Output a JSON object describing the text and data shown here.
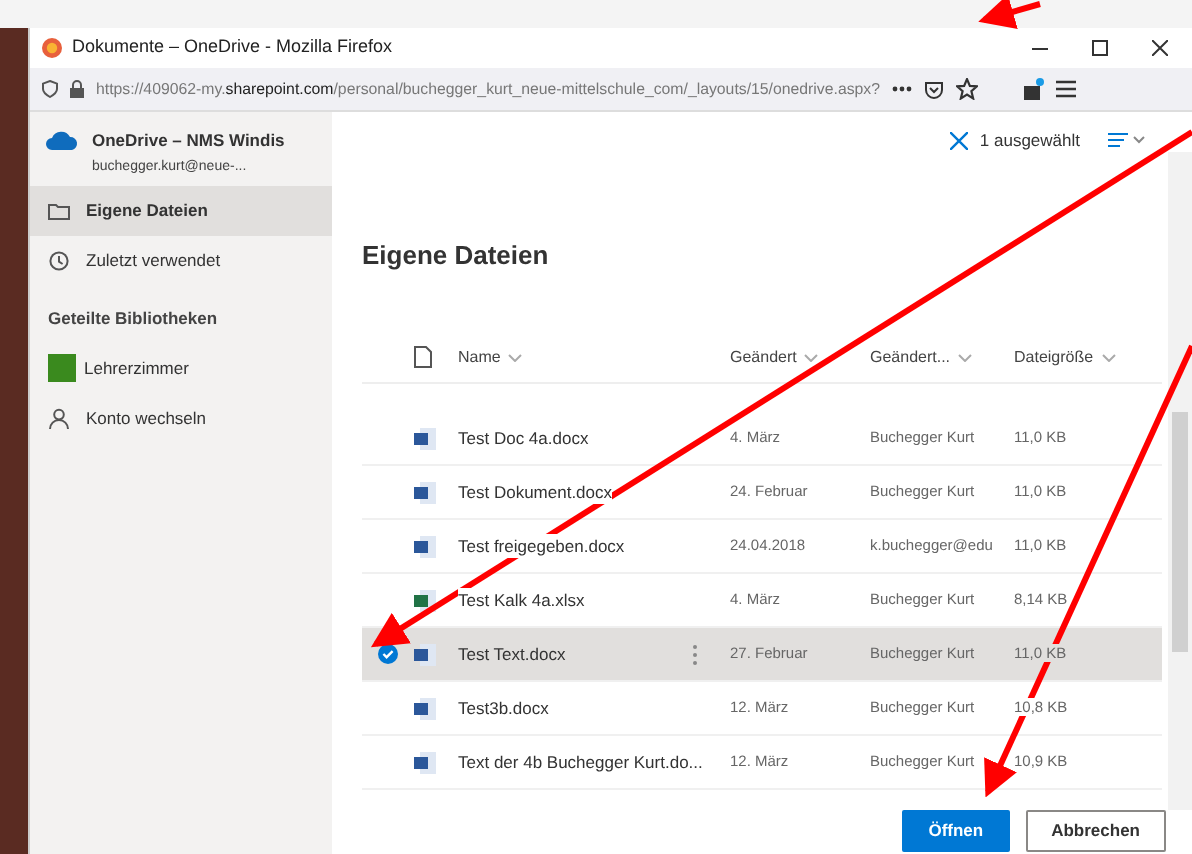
{
  "window": {
    "title": "Dokumente – OneDrive - Mozilla Firefox",
    "url": "https://409062-my.**sharepoint.com**/personal/buchegger_kurt_neue-mittelschule_com/_layouts/15/onedrive.aspx?"
  },
  "sidebar": {
    "account": "OneDrive – NMS Windis",
    "email": "buchegger.kurt@neue-...",
    "items": [
      {
        "kind": "folder",
        "label": "Eigene Dateien",
        "selected": true
      },
      {
        "kind": "recent",
        "label": "Zuletzt verwendet",
        "selected": false
      },
      {
        "kind": "section",
        "label": "Geteilte Bibliotheken"
      },
      {
        "kind": "library",
        "label": "Lehrerzimmer",
        "color": "#3a8a1e",
        "selected": false
      },
      {
        "kind": "account",
        "label": "Konto wechseln",
        "selected": false
      }
    ]
  },
  "toolbar": {
    "selection": "1 ausgewählt"
  },
  "heading": "Eigene Dateien",
  "table": {
    "columns": [
      "Name",
      "Geändert",
      "Geändert...",
      "Dateigröße"
    ],
    "rows": [
      {
        "kind": "word",
        "name": "Test Doc 4a.docx",
        "modified": "4. März",
        "modified_by": "Buchegger Kurt",
        "size": "11,0 KB",
        "selected": false
      },
      {
        "kind": "word",
        "name": "Test Dokument.docx",
        "modified": "24. Februar",
        "modified_by": "Buchegger Kurt",
        "size": "11,0 KB",
        "selected": false
      },
      {
        "kind": "word",
        "name": "Test freigegeben.docx",
        "modified": "24.04.2018",
        "modified_by": "k.buchegger@edu",
        "size": "11,0 KB",
        "selected": false
      },
      {
        "kind": "excel",
        "name": "Test Kalk 4a.xlsx",
        "modified": "4. März",
        "modified_by": "Buchegger Kurt",
        "size": "8,14 KB",
        "selected": false
      },
      {
        "kind": "word",
        "name": "Test Text.docx",
        "modified": "27. Februar",
        "modified_by": "Buchegger Kurt",
        "size": "11,0 KB",
        "selected": true
      },
      {
        "kind": "word",
        "name": "Test3b.docx",
        "modified": "12. März",
        "modified_by": "Buchegger Kurt",
        "size": "10,8 KB",
        "selected": false
      },
      {
        "kind": "word",
        "name": "Text der 4b Buchegger Kurt.do...",
        "modified": "12. März",
        "modified_by": "Buchegger Kurt",
        "size": "10,9 KB",
        "selected": false
      }
    ]
  },
  "buttons": [
    {
      "kind": "primary",
      "label": "Öffnen"
    },
    {
      "kind": "secondary",
      "label": "Abbrechen"
    }
  ]
}
